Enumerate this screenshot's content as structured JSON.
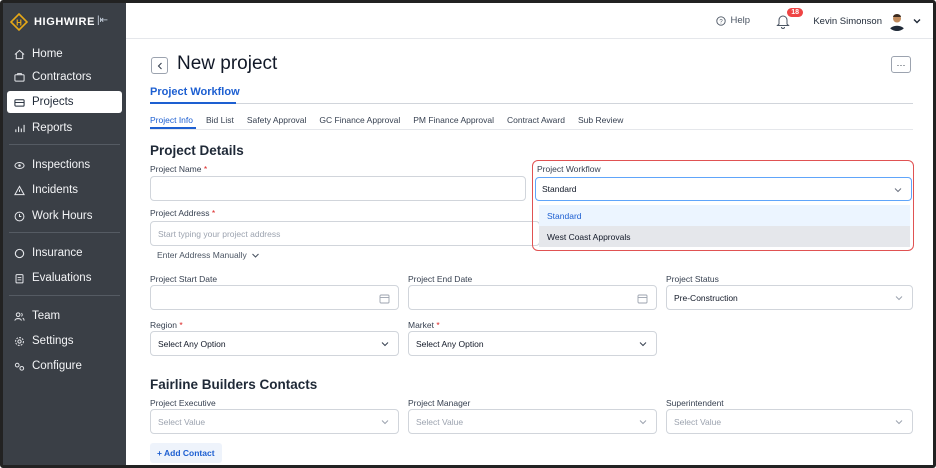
{
  "app": {
    "brand": "HIGHWIRE"
  },
  "sidebar": {
    "items": [
      {
        "label": "Home",
        "icon": "home-icon"
      },
      {
        "label": "Contractors",
        "icon": "contractors-icon"
      },
      {
        "label": "Projects",
        "icon": "projects-icon",
        "active": true
      },
      {
        "label": "Reports",
        "icon": "reports-icon"
      },
      {
        "label": "Inspections",
        "icon": "inspections-icon"
      },
      {
        "label": "Incidents",
        "icon": "warning-icon"
      },
      {
        "label": "Work Hours",
        "icon": "clock-icon"
      },
      {
        "label": "Insurance",
        "icon": "insurance-icon"
      },
      {
        "label": "Evaluations",
        "icon": "clipboard-icon"
      },
      {
        "label": "Team",
        "icon": "team-icon"
      },
      {
        "label": "Settings",
        "icon": "gear-icon"
      },
      {
        "label": "Configure",
        "icon": "configure-icon"
      }
    ]
  },
  "topbar": {
    "help_label": "Help",
    "notification_count": "18",
    "user_name": "Kevin Simonson"
  },
  "page": {
    "title": "New project",
    "workflow_tab": "Project Workflow",
    "subtabs": [
      "Project Info",
      "Bid List",
      "Safety Approval",
      "GC Finance Approval",
      "PM Finance Approval",
      "Contract Award",
      "Sub Review"
    ]
  },
  "details": {
    "section_title": "Project Details",
    "project_name_label": "Project Name",
    "project_name_value": "",
    "project_workflow_label": "Project Workflow",
    "project_workflow_value": "Standard",
    "workflow_options": [
      "Standard",
      "West Coast Approvals"
    ],
    "project_address_label": "Project Address",
    "project_address_placeholder": "Start typing your project address",
    "enter_address_manually": "Enter Address Manually",
    "start_date_label": "Project Start Date",
    "end_date_label": "Project End Date",
    "status_label": "Project Status",
    "status_value": "Pre-Construction",
    "region_label": "Region",
    "region_value": "Select Any Option",
    "market_label": "Market",
    "market_value": "Select Any Option",
    "required_mark": "*"
  },
  "contacts": {
    "section_title": "Fairline Builders Contacts",
    "executive_label": "Project Executive",
    "manager_label": "Project Manager",
    "superintendent_label": "Superintendent",
    "placeholder": "Select Value",
    "add_contact": "+ Add Contact"
  },
  "colors": {
    "sidebar_bg": "#3a3f46",
    "accent": "#1d5fd1",
    "highlight_border": "#e05252",
    "badge": "#ef4444"
  }
}
